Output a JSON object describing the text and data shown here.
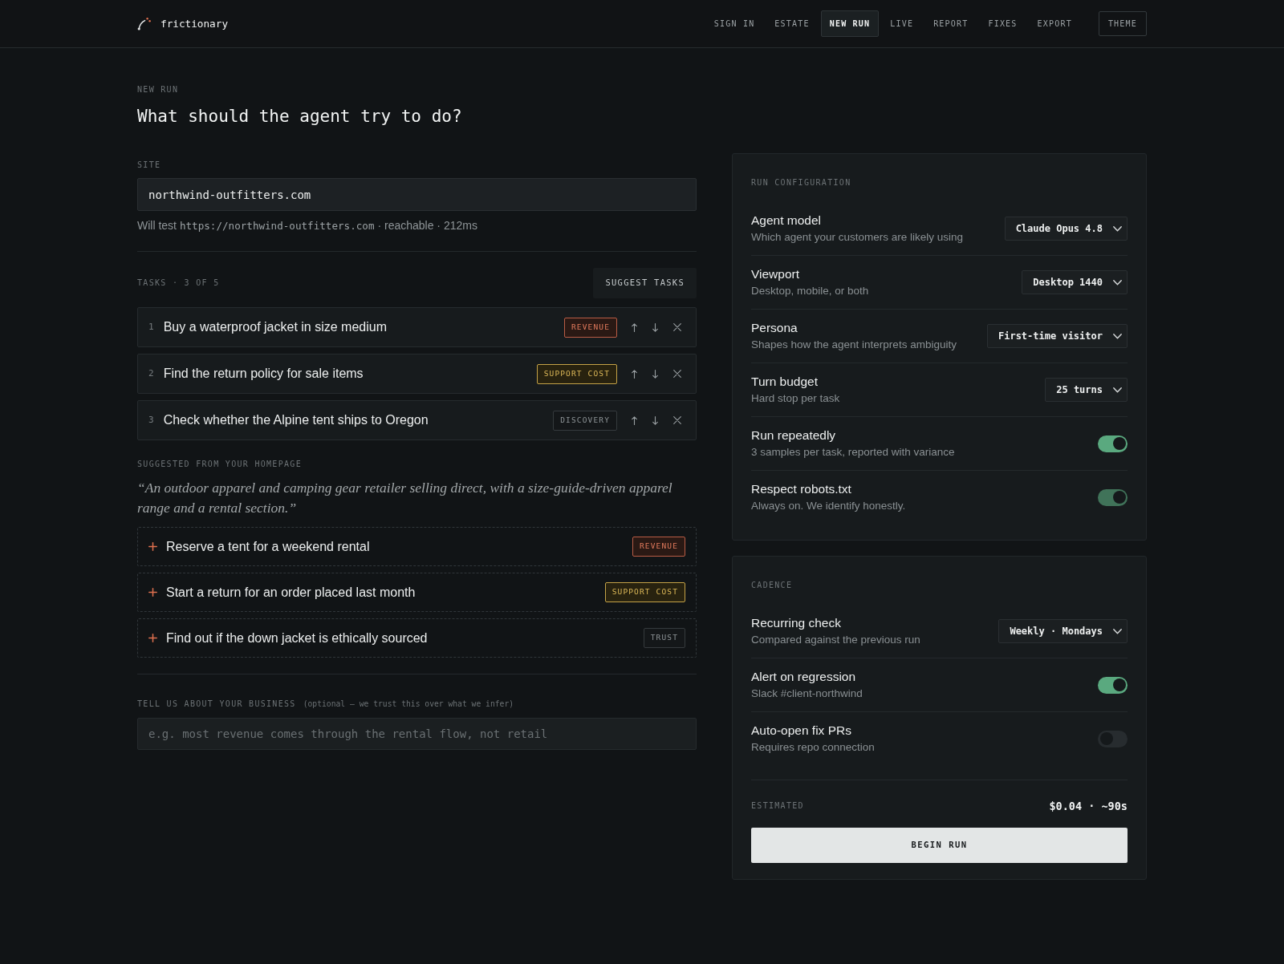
{
  "header": {
    "brand": "frictionary",
    "nav": [
      {
        "label": "SIGN IN",
        "selected": false
      },
      {
        "label": "ESTATE",
        "selected": false
      },
      {
        "label": "NEW RUN",
        "selected": true
      },
      {
        "label": "LIVE",
        "selected": false
      },
      {
        "label": "REPORT",
        "selected": false
      },
      {
        "label": "FIXES",
        "selected": false
      },
      {
        "label": "EXPORT",
        "selected": false
      }
    ],
    "theme_button": "THEME"
  },
  "page": {
    "eyebrow": "NEW RUN",
    "title": "What should the agent try to do?"
  },
  "site": {
    "label": "SITE",
    "value": "northwind-outfitters.com",
    "status": {
      "prefix": "Will test",
      "url": "https://northwind-outfitters.com",
      "suffix": "· reachable · 212ms"
    }
  },
  "tasks": {
    "heading": "TASKS · 3 OF 5",
    "suggest_button": "SUGGEST TASKS",
    "items": [
      {
        "number": "1",
        "text": "Buy a waterproof jacket in size medium",
        "tag": {
          "label": "REVENUE",
          "kind": "revenue"
        }
      },
      {
        "number": "2",
        "text": "Find the return policy for sale items",
        "tag": {
          "label": "SUPPORT COST",
          "kind": "support"
        }
      },
      {
        "number": "3",
        "text": "Check whether the Alpine tent ships to Oregon",
        "tag": {
          "label": "DISCOVERY",
          "kind": "neutral"
        }
      }
    ]
  },
  "suggestions": {
    "heading": "SUGGESTED FROM YOUR HOMEPAGE",
    "summary": "“An outdoor apparel and camping gear retailer selling direct, with a size-guide-driven apparel range and a rental section.”",
    "items": [
      {
        "text": "Reserve a tent for a weekend rental",
        "tag": {
          "label": "REVENUE",
          "kind": "revenue"
        }
      },
      {
        "text": "Start a return for an order placed last month",
        "tag": {
          "label": "SUPPORT COST",
          "kind": "support"
        }
      },
      {
        "text": "Find out if the down jacket is ethically sourced",
        "tag": {
          "label": "TRUST",
          "kind": "neutral"
        }
      }
    ]
  },
  "business": {
    "label": "TELL US ABOUT YOUR BUSINESS",
    "note": "(optional — we trust this over what we infer)",
    "placeholder": "e.g. most revenue comes through the rental flow, not retail"
  },
  "run_configuration": {
    "heading": "RUN CONFIGURATION",
    "rows": [
      {
        "kind": "select",
        "label": "Agent model",
        "description": "Which agent your customers are likely using",
        "value": "Claude Opus 4.8"
      },
      {
        "kind": "select",
        "label": "Viewport",
        "description": "Desktop, mobile, or both",
        "value": "Desktop 1440"
      },
      {
        "kind": "select",
        "label": "Persona",
        "description": "Shapes how the agent interprets ambiguity",
        "value": "First-time visitor"
      },
      {
        "kind": "select",
        "label": "Turn budget",
        "description": "Hard stop per task",
        "value": "25 turns"
      },
      {
        "kind": "toggle",
        "label": "Run repeatedly",
        "description": "3 samples per task, reported with variance",
        "on": true,
        "disabled": false
      },
      {
        "kind": "toggle",
        "label": "Respect robots.txt",
        "description": "Always on. We identify honestly.",
        "on": true,
        "disabled": true
      }
    ]
  },
  "cadence": {
    "heading": "CADENCE",
    "rows": [
      {
        "kind": "select",
        "label": "Recurring check",
        "description": "Compared against the previous run",
        "value": "Weekly · Mondays"
      },
      {
        "kind": "toggle",
        "label": "Alert on regression",
        "description": "Slack #client-northwind",
        "on": true,
        "disabled": false
      },
      {
        "kind": "toggle",
        "label": "Auto-open fix PRs",
        "description": "Requires repo connection",
        "on": false,
        "disabled": false
      }
    ],
    "estimate": {
      "label": "ESTIMATED",
      "value": "$0.04 · ~90s"
    },
    "begin_button": "BEGIN RUN"
  }
}
